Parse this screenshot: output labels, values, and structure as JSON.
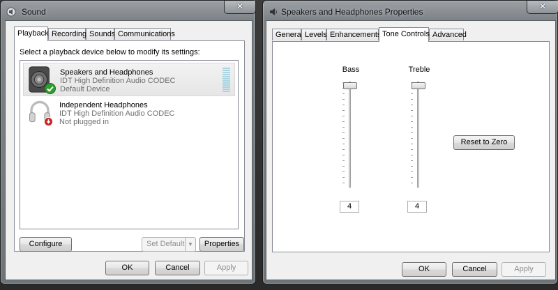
{
  "sound_window": {
    "title": "Sound",
    "close_symbol": "✕",
    "tabs": [
      {
        "label": "Playback",
        "active": true
      },
      {
        "label": "Recording",
        "active": false
      },
      {
        "label": "Sounds",
        "active": false
      },
      {
        "label": "Communications",
        "active": false
      }
    ],
    "instruction": "Select a playback device below to modify its settings:",
    "devices": [
      {
        "name": "Speakers and Headphones",
        "driver": "IDT High Definition Audio CODEC",
        "status": "Default Device",
        "icon": "speaker-icon",
        "badge": "green-check-icon",
        "selected": true
      },
      {
        "name": "Independent Headphones",
        "driver": "IDT High Definition Audio CODEC",
        "status": "Not plugged in",
        "icon": "headphones-icon",
        "badge": "red-unplugged-icon",
        "selected": false
      }
    ],
    "buttons": {
      "configure": "Configure",
      "set_default": "Set Default",
      "properties": "Properties",
      "ok": "OK",
      "cancel": "Cancel",
      "apply": "Apply"
    }
  },
  "properties_window": {
    "title": "Speakers and Headphones Properties",
    "close_symbol": "✕",
    "tabs": [
      {
        "label": "General",
        "active": false
      },
      {
        "label": "Levels",
        "active": false
      },
      {
        "label": "Enhancements",
        "active": false
      },
      {
        "label": "Tone Controls",
        "active": true
      },
      {
        "label": "Advanced",
        "active": false
      }
    ],
    "bass": {
      "label": "Bass",
      "value": "4"
    },
    "treble": {
      "label": "Treble",
      "value": "4"
    },
    "buttons": {
      "reset": "Reset to Zero",
      "ok": "OK",
      "cancel": "Cancel",
      "apply": "Apply"
    }
  },
  "colors": {
    "check_green": "#2f9e2f",
    "unplug_red": "#c62828",
    "meter_blue": "#a9d4e0"
  }
}
